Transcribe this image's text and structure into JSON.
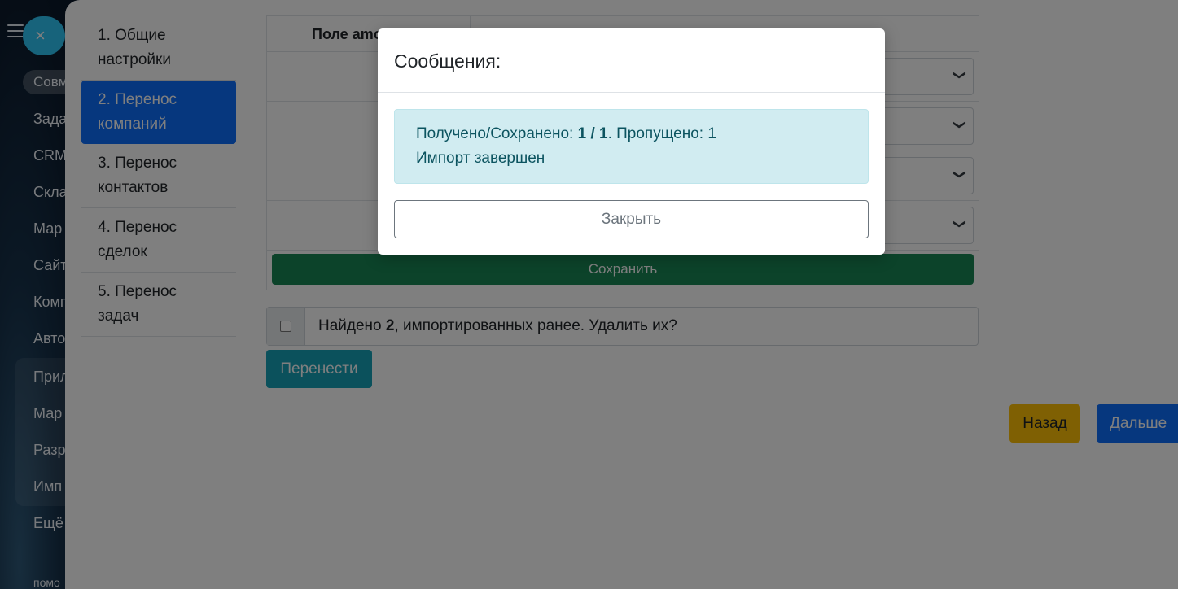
{
  "crm_sidebar": {
    "close_icon": "×",
    "pill_label": "Совм",
    "items": [
      "Зада",
      "CRM",
      "Скла",
      "Мар",
      "Сайт",
      "Комп",
      "Авто",
      "Прил",
      "Мар",
      "Разр",
      "Имп",
      "Ещё",
      "помо"
    ]
  },
  "steps": [
    {
      "label": "1. Общие\nнастройки"
    },
    {
      "label": "2. Перенос\nкомпаний"
    },
    {
      "label": "3. Перенос\nконтактов"
    },
    {
      "label": "4. Перенос\nсделок"
    },
    {
      "label": "5. Перенос\nзадач"
    }
  ],
  "table": {
    "header_left": "Поле amo",
    "chevron": "❯",
    "save_label": "Сохранить"
  },
  "found": {
    "prefix": "Найдено ",
    "count": "2",
    "suffix": ", импортированных ранее. Удалить их?"
  },
  "buttons": {
    "transfer": "Перенести",
    "back": "Назад",
    "next": "Дальше"
  },
  "modal": {
    "title": "Сообщения:",
    "line1_prefix": "Получено/Сохранено: ",
    "line1_value": "1 / 1",
    "line1_suffix": ". Пропущено: 1",
    "line2": "Импорт завершен",
    "close_label": "Закрыть"
  }
}
